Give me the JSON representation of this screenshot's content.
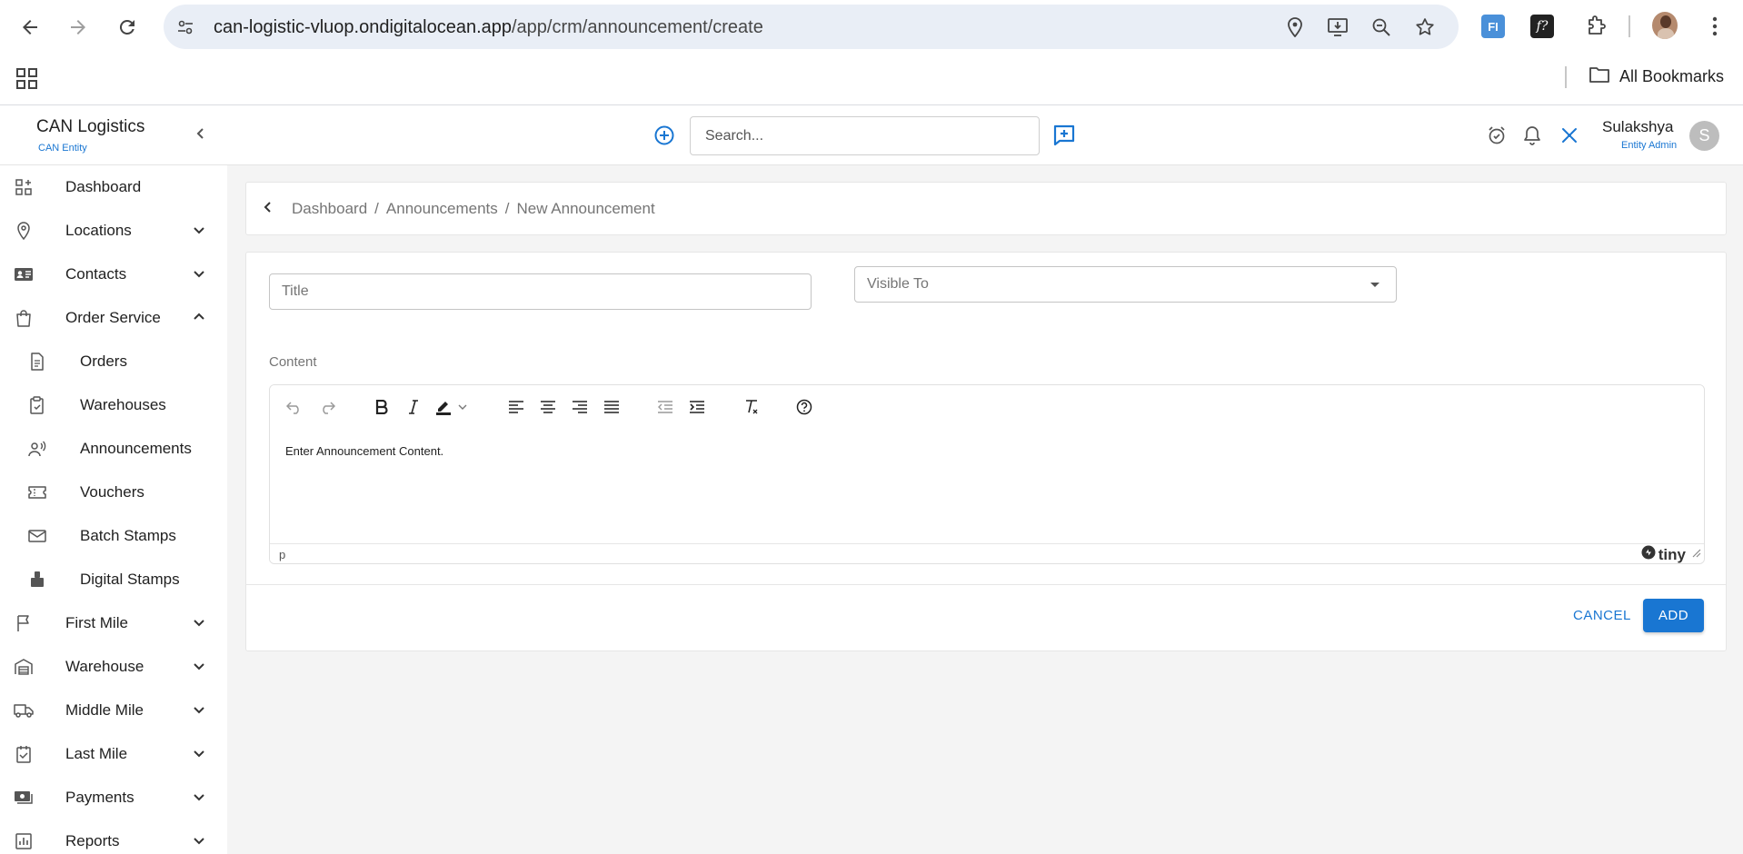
{
  "browser": {
    "url_host": "can-logistic-vluop.ondigitalocean.app",
    "url_path": "/app/crm/announcement/create",
    "all_bookmarks": "All Bookmarks",
    "ext_fi_label": "FI",
    "ext_f_label": "f?"
  },
  "header": {
    "brand_title": "CAN Logistics",
    "brand_subtitle": "CAN Entity",
    "search_placeholder": "Search...",
    "user_name": "Sulakshya",
    "user_role": "Entity Admin",
    "avatar_initial": "S"
  },
  "sidebar": {
    "items": [
      {
        "label": "Dashboard",
        "icon": "dashboard-icon"
      },
      {
        "label": "Locations",
        "icon": "location-pin-icon"
      },
      {
        "label": "Contacts",
        "icon": "contact-card-icon"
      },
      {
        "label": "Order Service",
        "icon": "shopping-bag-icon"
      },
      {
        "label": "Orders",
        "icon": "document-icon"
      },
      {
        "label": "Warehouses",
        "icon": "clipboard-check-icon"
      },
      {
        "label": "Announcements",
        "icon": "announcement-icon"
      },
      {
        "label": "Vouchers",
        "icon": "ticket-icon"
      },
      {
        "label": "Batch Stamps",
        "icon": "mail-icon"
      },
      {
        "label": "Digital Stamps",
        "icon": "stamp-icon"
      },
      {
        "label": "First Mile",
        "icon": "flag-icon"
      },
      {
        "label": "Warehouse",
        "icon": "warehouse-icon"
      },
      {
        "label": "Middle Mile",
        "icon": "truck-icon"
      },
      {
        "label": "Last Mile",
        "icon": "checklist-icon"
      },
      {
        "label": "Payments",
        "icon": "payments-icon"
      },
      {
        "label": "Reports",
        "icon": "reports-icon"
      }
    ]
  },
  "breadcrumb": {
    "items": [
      "Dashboard",
      "Announcements",
      "New Announcement"
    ],
    "separator": "/"
  },
  "form": {
    "title_placeholder": "Title",
    "visible_to_placeholder": "Visible To",
    "content_label": "Content",
    "editor_content": "Enter Announcement Content.",
    "editor_status_path": "p",
    "editor_brand": "tiny",
    "cancel_label": "CANCEL",
    "add_label": "ADD"
  },
  "colors": {
    "primary": "#1976d2",
    "main_background": "#f4f4f4",
    "url_bar": "#e9eef6"
  }
}
